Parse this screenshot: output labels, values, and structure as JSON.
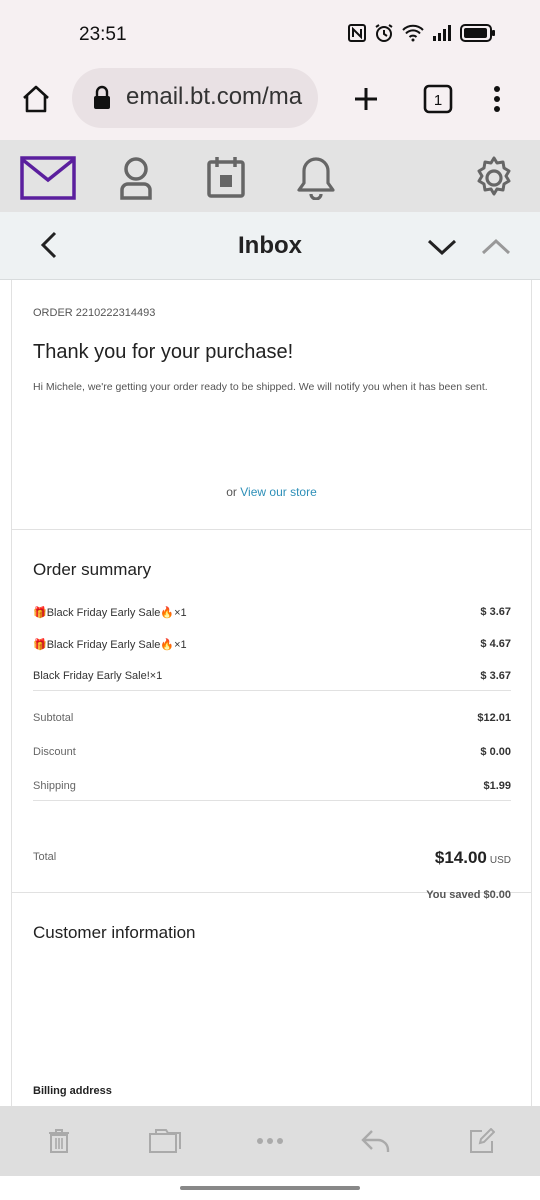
{
  "status": {
    "time": "23:51"
  },
  "browser": {
    "url": "email.bt.com/ma",
    "tab_count": "1"
  },
  "header": {
    "title": "Inbox"
  },
  "email": {
    "order_number": "ORDER 2210222314493",
    "heading": "Thank you for your purchase!",
    "intro": "Hi Michele, we're getting your order ready to be shipped. We will notify you when it has been sent.",
    "store_prefix": "or ",
    "store_link": "View our store"
  },
  "summary": {
    "title": "Order summary",
    "items": [
      {
        "name": "🎁Black Friday Early Sale🔥×1",
        "price": "$ 3.67"
      },
      {
        "name": "🎁Black Friday Early Sale🔥×1",
        "price": "$ 4.67"
      },
      {
        "name": "Black Friday Early Sale!×1",
        "price": "$ 3.67"
      }
    ],
    "subtotal_label": "Subtotal",
    "subtotal": "$12.01",
    "discount_label": "Discount",
    "discount": "$ 0.00",
    "shipping_label": "Shipping",
    "shipping": "$1.99",
    "total_label": "Total",
    "total": "$14.00",
    "currency": "USD",
    "saved": "You saved $0.00"
  },
  "customer": {
    "title": "Customer information",
    "billing_label": "Billing address"
  },
  "colors": {
    "accent": "#5b1f9e",
    "link": "#2d8fb8"
  }
}
